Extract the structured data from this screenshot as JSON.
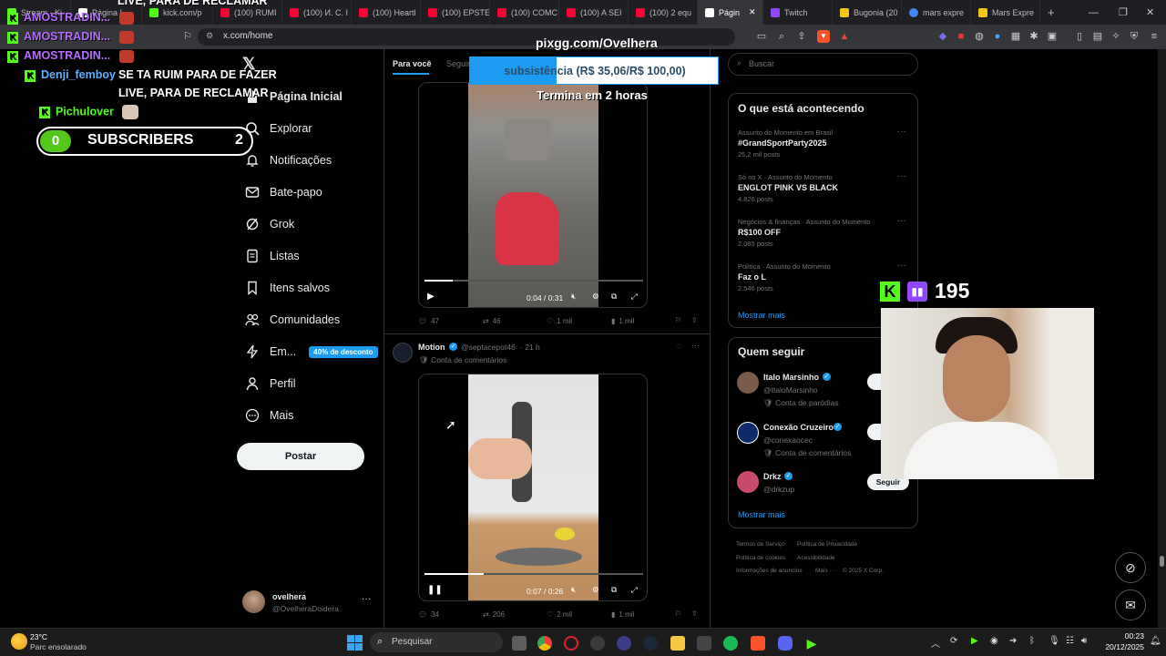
{
  "browser": {
    "tabs": [
      {
        "label": "Stream - Ki",
        "color": "#53fc18"
      },
      {
        "label": "Página I",
        "color": "#ffffff"
      },
      {
        "label": "kick.com/p",
        "color": "#53fc18"
      },
      {
        "label": "(100) RUMI",
        "color": "#ff0033"
      },
      {
        "label": "(100) И. С. I",
        "color": "#ff0033"
      },
      {
        "label": "(100) Heartl",
        "color": "#ff0033"
      },
      {
        "label": "(100) EPSTE",
        "color": "#ff0033"
      },
      {
        "label": "(100) COMC",
        "color": "#ff0033"
      },
      {
        "label": "(100) A SEI",
        "color": "#ff0033"
      },
      {
        "label": "(100) 2 equ",
        "color": "#ff0033"
      },
      {
        "label": "Págin",
        "color": "#ffffff"
      },
      {
        "label": "Twitch",
        "color": "#9146ff"
      },
      {
        "label": "Bugonia (20",
        "color": "#f5c518"
      },
      {
        "label": "mars expre",
        "color": "#4285f4"
      },
      {
        "label": "Mars Expre",
        "color": "#f5c518"
      }
    ],
    "url": "x.com/home"
  },
  "overlay": {
    "chat": [
      {
        "user": "AMOSTRADIN...",
        "message": "",
        "color": "#b56cff"
      },
      {
        "user": "AMOSTRADIN...",
        "message": "",
        "color": "#b56cff"
      },
      {
        "user": "AMOSTRADIN...",
        "message": "",
        "color": "#b56cff"
      },
      {
        "user": "Denji_femboy",
        "message": "SE TA RUIM PARA DE FAZER",
        "color": "#5db0ff"
      },
      {
        "user": "",
        "message": "LIVE, PARA DE RECLAMAR",
        "color": "#ffffff"
      },
      {
        "user": "Pichulover",
        "message": "",
        "color": "#53fc18"
      }
    ],
    "top_partial_text": "LIVE, PARA DE RECLAMAR",
    "sub_goal": {
      "left": "0",
      "label": "SUBSCRIBERS",
      "right": "2"
    },
    "pix_url": "pixgg.com/Ovelhera",
    "goal_text": "subsistência (R$ 35,06/R$ 100,00)",
    "goal_progress": 0.3506,
    "goal_timer": "Termina em 2 horas",
    "viewer_count": "195"
  },
  "nav": {
    "items": [
      {
        "label": "Página Inicial",
        "icon": "home-icon"
      },
      {
        "label": "Explorar",
        "icon": "search-icon"
      },
      {
        "label": "Notificações",
        "icon": "bell-icon"
      },
      {
        "label": "Bate-papo",
        "icon": "mail-icon"
      },
      {
        "label": "Grok",
        "icon": "grok-icon"
      },
      {
        "label": "Listas",
        "icon": "list-icon"
      },
      {
        "label": "Itens salvos",
        "icon": "bookmark-icon"
      },
      {
        "label": "Comunidades",
        "icon": "people-icon"
      },
      {
        "label": "Em...",
        "icon": "bolt-icon"
      },
      {
        "label": "Perfil",
        "icon": "person-icon"
      },
      {
        "label": "Mais",
        "icon": "more-icon"
      }
    ],
    "discount_badge": "40% de desconto",
    "post_button": "Postar",
    "account": {
      "name": "ovelhera",
      "handle": "@OvelheraDoidera"
    }
  },
  "feed": {
    "tabs": [
      "Para você",
      "Seguin"
    ],
    "post1": {
      "time": "0:04 / 0:31",
      "replies": "47",
      "reposts": "46",
      "likes": "1 mil",
      "views": "1 mil"
    },
    "post2": {
      "author": "Motion",
      "handle": "@septacepot46",
      "ago": "· 21 h",
      "label": "Conta de comentários",
      "time": "0:07 / 0:26",
      "replies": "34",
      "reposts": "206",
      "likes": "2 mil",
      "views": "1 mil"
    }
  },
  "right": {
    "search_placeholder": "Buscar",
    "trends_title": "O que está acontecendo",
    "trends": [
      {
        "meta": "Assunto do Momento em Brasil",
        "title": "#GrandSportParty2025",
        "posts": "25,2 mil posts"
      },
      {
        "meta": "Só no X · Assunto do Momento",
        "title": "ENGLOT PINK VS BLACK",
        "posts": "4.826 posts"
      },
      {
        "meta": "Negócios & finanças · Assunto do Momento",
        "title": "R$100 OFF",
        "posts": "2.085 posts"
      },
      {
        "meta": "Política · Assunto do Momento",
        "title": "Faz o L",
        "posts": "2.546 posts"
      }
    ],
    "show_more": "Mostrar mais",
    "who_title": "Quem seguir",
    "who": [
      {
        "name": "Italo Marsinho",
        "handle": "@ItaloMarsinho",
        "label": "Conta de paródias",
        "button": "S"
      },
      {
        "name": "Conexão Cruzeiro",
        "handle": "@conexaocec",
        "label": "Conta de comentários",
        "button": "S"
      },
      {
        "name": "Drkz",
        "handle": "@drkzup",
        "label": "",
        "button": "Seguir"
      }
    ],
    "who_more": "Mostrar mais",
    "footer": [
      "Termos de Serviço",
      "Política de Privacidade",
      "Política de cookies",
      "Acessibilidade",
      "Informações de anúncios",
      "Mais ···",
      "© 2025 X Corp."
    ]
  },
  "taskbar": {
    "weather_temp": "23°C",
    "weather_desc": "Parc ensolarado",
    "search": "Pesquisar",
    "time": "00:23",
    "date": "20/12/2025"
  }
}
